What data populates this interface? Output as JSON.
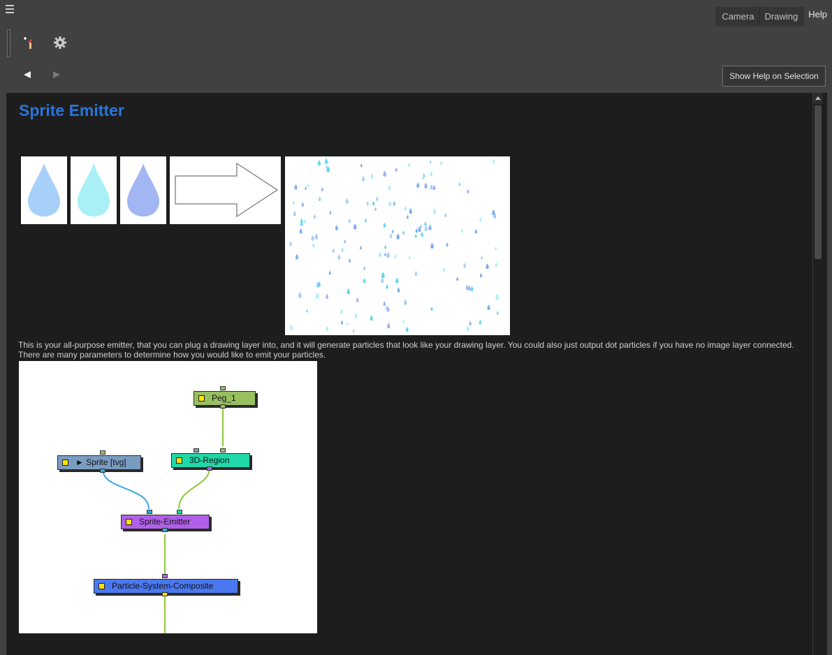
{
  "tabs": [
    {
      "label": "Camera",
      "active": false
    },
    {
      "label": "Drawing",
      "active": false
    },
    {
      "label": "Help",
      "active": true
    }
  ],
  "toolbar": {
    "icons": [
      "add-tool-icon",
      "gear-icon"
    ]
  },
  "nav": {
    "back_icon": "back-arrow-icon",
    "forward_icon": "forward-arrow-icon"
  },
  "show_help_button": "Show Help on Selection",
  "help_page": {
    "title": "Sprite Emitter",
    "drop_colors": [
      "#a6d0f7",
      "#a8f0f6",
      "#a2b6f4"
    ],
    "description": "This is your all-purpose emitter, that you can plug a drawing layer into, and it will generate particles that look like your drawing layer. You could also just output dot particles if you have no image layer connected. There are many parameters to determine how you would like to emit your particles."
  },
  "node_graph": {
    "nodes": [
      {
        "id": "peg",
        "label": "Peg_1",
        "color": "#98c060"
      },
      {
        "id": "region",
        "label": "3D-Region",
        "color": "#20d8a8"
      },
      {
        "id": "sprite",
        "label": "Sprite  [tvg]",
        "color": "#7a9cc0"
      },
      {
        "id": "emitter",
        "label": "Sprite-Emitter",
        "color": "#b060e8"
      },
      {
        "id": "composite",
        "label": "Particle-System-Composite",
        "color": "#4a78f0"
      }
    ]
  }
}
